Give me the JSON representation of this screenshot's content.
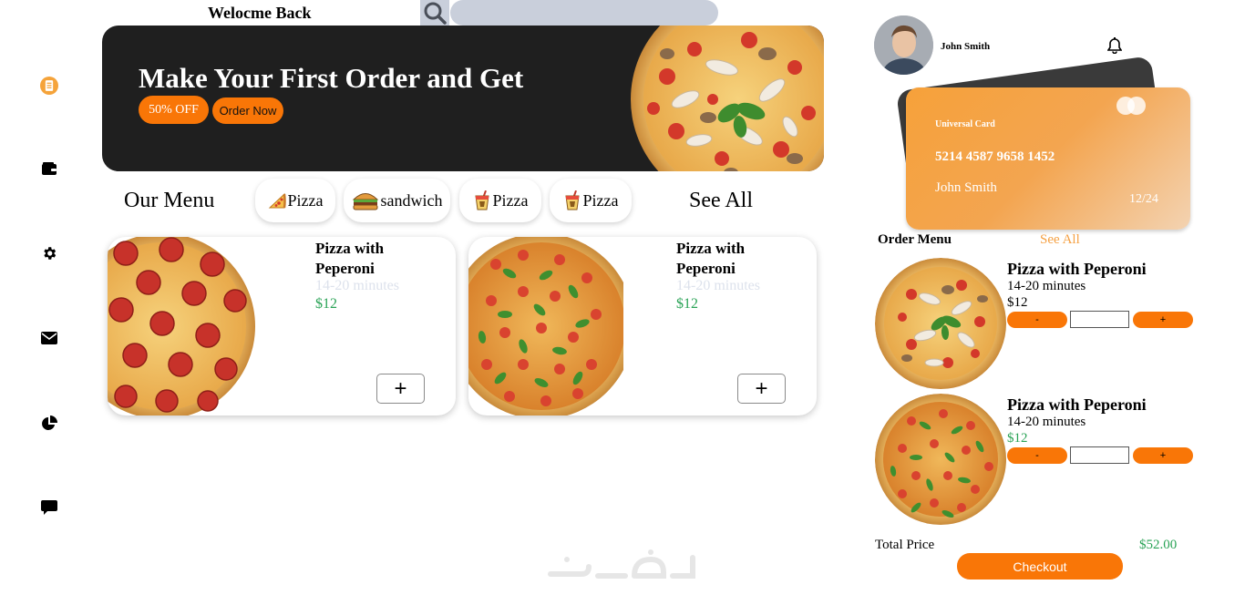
{
  "header": {
    "welcome": "Welocme Back",
    "search_placeholder": ""
  },
  "sidebar": {
    "items": [
      {
        "icon": "menu-list-icon",
        "active": true
      },
      {
        "icon": "wallet-icon"
      },
      {
        "icon": "gear-icon"
      },
      {
        "icon": "mail-icon"
      },
      {
        "icon": "pie-chart-icon"
      },
      {
        "icon": "chat-icon"
      }
    ]
  },
  "banner": {
    "title": "Make Your First Order and Get",
    "discount": "50% OFF",
    "order_button": "Order Now"
  },
  "menu": {
    "title": "Our Menu",
    "see_all": "See All",
    "categories": [
      {
        "label": "Pizza",
        "icon": "pizza-slice-icon"
      },
      {
        "label": "sandwich",
        "icon": "burger-icon"
      },
      {
        "label": "Pizza",
        "icon": "drink-icon"
      },
      {
        "label": "Pizza",
        "icon": "drink-icon"
      }
    ],
    "items": [
      {
        "title": "Pizza with Peperoni",
        "time": "14-20 minutes",
        "price": "$12",
        "add": "+"
      },
      {
        "title": "Pizza with Peperoni",
        "time": "14-20 minutes",
        "price": "$12",
        "add": "+"
      }
    ]
  },
  "user": {
    "name": "John Smith"
  },
  "card": {
    "label": "Universal Card",
    "number": "5214 4587 9658 1452",
    "holder": "John Smith",
    "expiry": "12/24"
  },
  "order": {
    "title": "Order Menu",
    "see_all": "See All",
    "items": [
      {
        "title": "Pizza with Peperoni",
        "time": "14-20 minutes",
        "price": "$12",
        "minus": "-",
        "plus": "+"
      },
      {
        "title": "Pizza with Peperoni",
        "time": "14-20 minutes",
        "price": "$12",
        "minus": "-",
        "plus": "+"
      }
    ],
    "total_label": "Total Price",
    "total_value": "$52.00",
    "checkout": "Checkout"
  },
  "colors": {
    "accent": "#f97607",
    "price_green": "#2aa356",
    "banner_bg": "#1f1f1f",
    "search_bg": "#c9cfdb"
  }
}
